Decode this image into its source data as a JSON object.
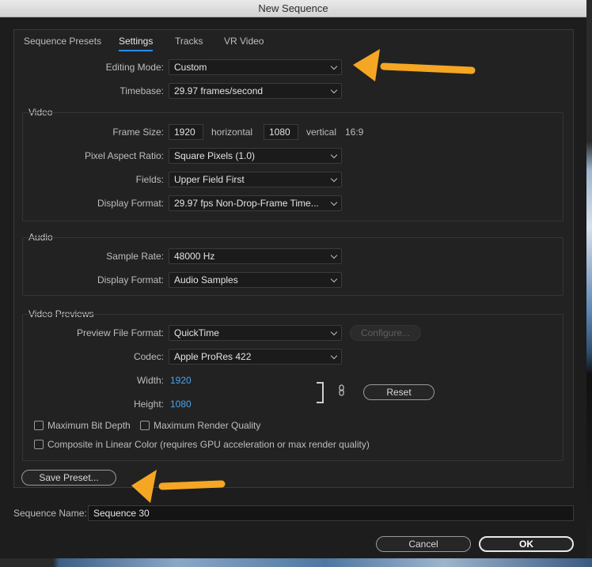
{
  "window": {
    "title": "New Sequence"
  },
  "tabs": [
    {
      "label": "Sequence Presets"
    },
    {
      "label": "Settings",
      "active": true
    },
    {
      "label": "Tracks"
    },
    {
      "label": "VR Video"
    }
  ],
  "settings": {
    "editing_mode": {
      "label": "Editing Mode:",
      "value": "Custom"
    },
    "timebase": {
      "label": "Timebase:",
      "value": "29.97  frames/second"
    }
  },
  "video": {
    "title": "Video",
    "frame_size": {
      "label": "Frame Size:",
      "width": "1920",
      "horizontal_label": "horizontal",
      "height": "1080",
      "vertical_label": "vertical",
      "aspect": "16:9"
    },
    "pixel_aspect_ratio": {
      "label": "Pixel Aspect Ratio:",
      "value": "Square Pixels (1.0)"
    },
    "fields": {
      "label": "Fields:",
      "value": "Upper Field First"
    },
    "display_format": {
      "label": "Display Format:",
      "value": "29.97 fps Non-Drop-Frame Time..."
    }
  },
  "audio": {
    "title": "Audio",
    "sample_rate": {
      "label": "Sample Rate:",
      "value": "48000 Hz"
    },
    "display_format": {
      "label": "Display Format:",
      "value": "Audio Samples"
    }
  },
  "video_previews": {
    "title": "Video Previews",
    "preview_file_format": {
      "label": "Preview File Format:",
      "value": "QuickTime"
    },
    "configure_label": "Configure...",
    "codec": {
      "label": "Codec:",
      "value": "Apple ProRes 422"
    },
    "width": {
      "label": "Width:",
      "value": "1920"
    },
    "height": {
      "label": "Height:",
      "value": "1080"
    },
    "reset_label": "Reset",
    "max_bit_depth": "Maximum Bit Depth",
    "max_render_quality": "Maximum Render Quality",
    "composite_linear": "Composite in Linear Color (requires GPU acceleration or max render quality)"
  },
  "save_preset_label": "Save Preset...",
  "sequence_name": {
    "label": "Sequence Name:",
    "value": "Sequence 30"
  },
  "footer": {
    "cancel_label": "Cancel",
    "ok_label": "OK"
  },
  "colors": {
    "accent_blue": "#2d8ceb",
    "annotation_arrow": "#f5a623",
    "value_blue": "#4aa3ef"
  }
}
